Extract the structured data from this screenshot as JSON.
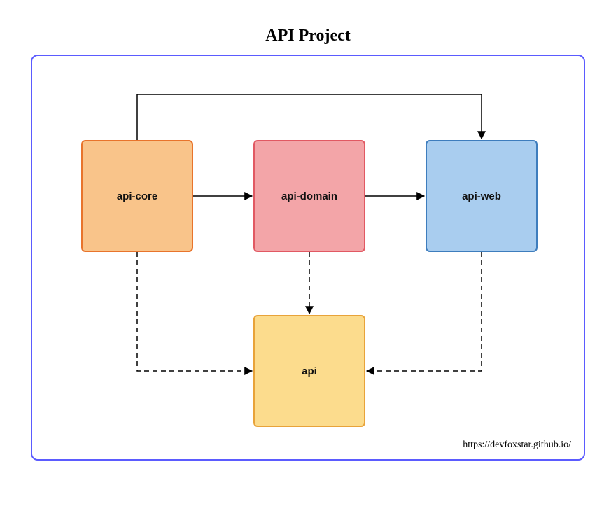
{
  "title": "API Project",
  "footer": "https://devfoxstar.github.io/",
  "nodes": {
    "core": {
      "label": "api-core"
    },
    "domain": {
      "label": "api-domain"
    },
    "web": {
      "label": "api-web"
    },
    "api": {
      "label": "api"
    }
  },
  "edges": [
    {
      "from": "api-core",
      "to": "api-domain",
      "style": "solid"
    },
    {
      "from": "api-domain",
      "to": "api-web",
      "style": "solid"
    },
    {
      "from": "api-core",
      "to": "api-web",
      "style": "solid",
      "routing": "top"
    },
    {
      "from": "api-core",
      "to": "api",
      "style": "dashed"
    },
    {
      "from": "api-domain",
      "to": "api",
      "style": "dashed"
    },
    {
      "from": "api-web",
      "to": "api",
      "style": "dashed"
    }
  ],
  "colors": {
    "border": "#5b5bff",
    "core": {
      "fill": "#f9c48a",
      "stroke": "#e8742c"
    },
    "domain": {
      "fill": "#f3a5a8",
      "stroke": "#e15963"
    },
    "web": {
      "fill": "#a9cdef",
      "stroke": "#3e7dbd"
    },
    "api": {
      "fill": "#fcdc8d",
      "stroke": "#e8a33a"
    }
  }
}
